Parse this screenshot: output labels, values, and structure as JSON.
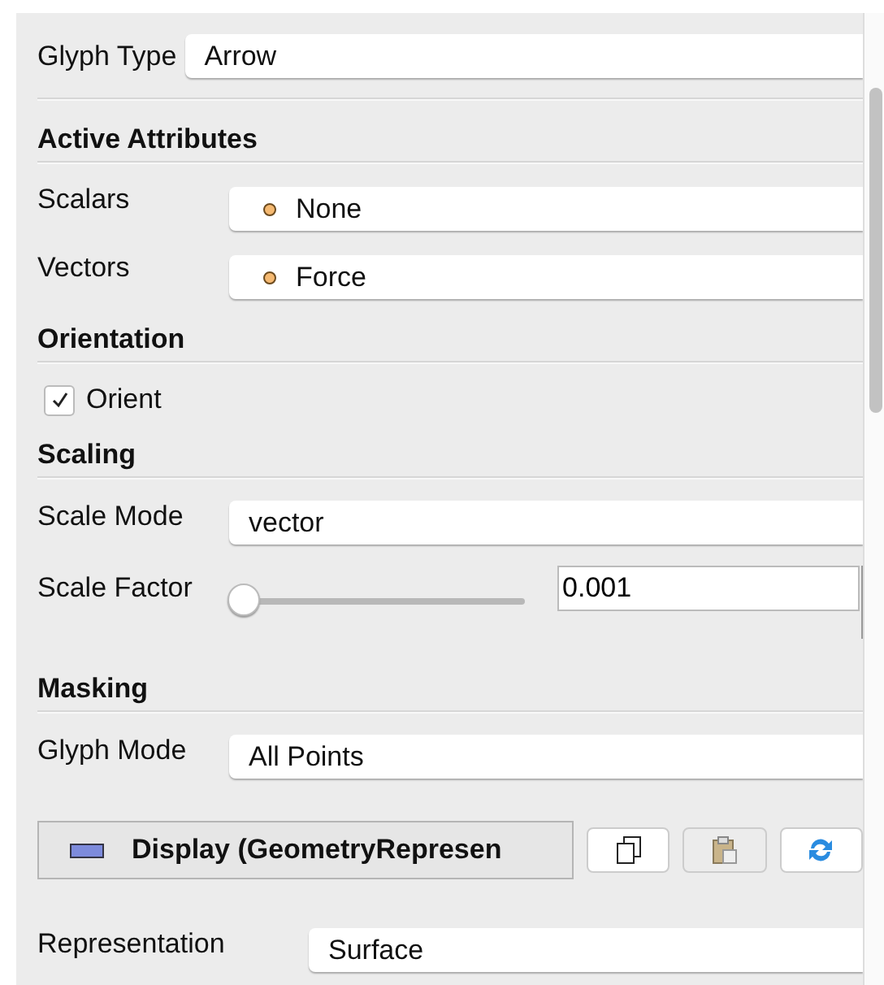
{
  "glyph_type": {
    "label": "Glyph Type",
    "value": "Arrow"
  },
  "sections": [
    {
      "title": "Active Attributes",
      "rows": [
        {
          "kind": "attribute",
          "label": "Scalars",
          "value": "None"
        },
        {
          "kind": "attribute",
          "label": "Vectors",
          "value": "Force"
        }
      ]
    },
    {
      "title": "Orientation",
      "rows": [
        {
          "kind": "checkbox",
          "label": "Orient",
          "checked": true
        }
      ]
    },
    {
      "title": "Scaling",
      "rows": [
        {
          "kind": "dropdown",
          "label": "Scale Mode",
          "value": "vector"
        },
        {
          "kind": "slider",
          "label": "Scale Factor",
          "level": 0.0,
          "value": "0.001"
        }
      ]
    },
    {
      "title": "Masking",
      "rows": [
        {
          "kind": "dropdown",
          "label": "Glyph Mode",
          "value": "All Points"
        }
      ]
    }
  ],
  "display": {
    "title": "Display (GeometryRepresen",
    "buttons": [
      {
        "kind": "copy",
        "disabled": false
      },
      {
        "kind": "paste",
        "disabled": true
      },
      {
        "kind": "reload",
        "disabled": false
      }
    ]
  },
  "representation": {
    "label": "Representation",
    "value": "Surface"
  }
}
